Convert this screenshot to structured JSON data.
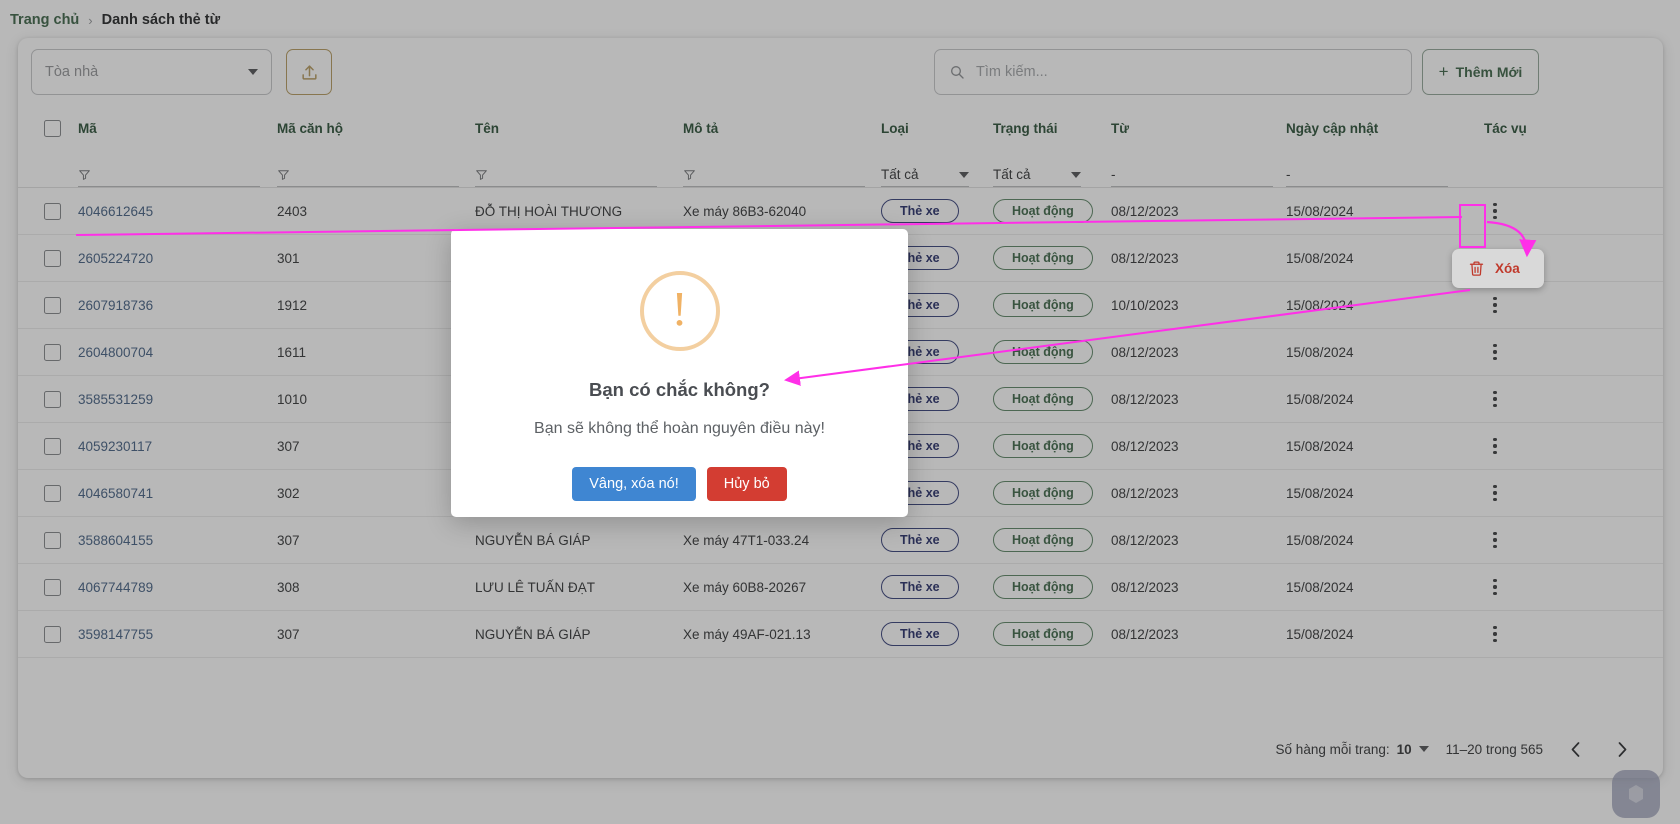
{
  "breadcrumb": {
    "home": "Trang chủ",
    "separator": "›",
    "current": "Danh sách thẻ từ"
  },
  "toolbar": {
    "building_placeholder": "Tòa nhà",
    "upload_icon": "upload-icon",
    "search_placeholder": "Tìm kiếm...",
    "search_value": "",
    "search_icon": "search-icon",
    "add_label": "Thêm Mới",
    "add_plus": "+"
  },
  "table": {
    "columns": [
      {
        "key": "ma",
        "label": "Mã"
      },
      {
        "key": "ma_can_ho",
        "label": "Mã căn hộ"
      },
      {
        "key": "ten",
        "label": "Tên"
      },
      {
        "key": "mo_ta",
        "label": "Mô tả"
      },
      {
        "key": "loai",
        "label": "Loại"
      },
      {
        "key": "trang_thai",
        "label": "Trạng thái"
      },
      {
        "key": "tu",
        "label": "Từ"
      },
      {
        "key": "ngay_cap_nhat",
        "label": "Ngày cập nhật"
      },
      {
        "key": "tac_vu",
        "label": "Tác vụ"
      }
    ],
    "filters": {
      "ma": "",
      "ma_can_ho": "",
      "ten": "",
      "mo_ta": "",
      "loai": "Tất cả",
      "trang_thai": "Tất cả",
      "tu": "-",
      "ngay_cap_nhat": "-"
    },
    "rows": [
      {
        "ma": "4046612645",
        "ma_can_ho": "2403",
        "ten": "ĐỖ THỊ HOÀI THƯƠNG",
        "mo_ta": "Xe máy 86B3-62040",
        "loai": "Thẻ xe",
        "trang_thai": "Hoạt động",
        "tu": "08/12/2023",
        "ngay_cap_nhat": "15/08/2024"
      },
      {
        "ma": "2605224720",
        "ma_can_ho": "301",
        "ten": "",
        "mo_ta": "",
        "loai": "Thẻ xe",
        "trang_thai": "Hoạt động",
        "tu": "08/12/2023",
        "ngay_cap_nhat": "15/08/2024"
      },
      {
        "ma": "2607918736",
        "ma_can_ho": "1912",
        "ten": "",
        "mo_ta": "",
        "loai": "Thẻ xe",
        "trang_thai": "Hoạt động",
        "tu": "10/10/2023",
        "ngay_cap_nhat": "15/08/2024"
      },
      {
        "ma": "2604800704",
        "ma_can_ho": "1611",
        "ten": "",
        "mo_ta": "",
        "loai": "Thẻ xe",
        "trang_thai": "Hoạt động",
        "tu": "08/12/2023",
        "ngay_cap_nhat": "15/08/2024"
      },
      {
        "ma": "3585531259",
        "ma_can_ho": "1010",
        "ten": "",
        "mo_ta": "",
        "loai": "Thẻ xe",
        "trang_thai": "Hoạt động",
        "tu": "08/12/2023",
        "ngay_cap_nhat": "15/08/2024"
      },
      {
        "ma": "4059230117",
        "ma_can_ho": "307",
        "ten": "",
        "mo_ta": "",
        "loai": "Thẻ xe",
        "trang_thai": "Hoạt động",
        "tu": "08/12/2023",
        "ngay_cap_nhat": "15/08/2024"
      },
      {
        "ma": "4046580741",
        "ma_can_ho": "302",
        "ten": "",
        "mo_ta": "",
        "loai": "Thẻ xe",
        "trang_thai": "Hoạt động",
        "tu": "08/12/2023",
        "ngay_cap_nhat": "15/08/2024"
      },
      {
        "ma": "3588604155",
        "ma_can_ho": "307",
        "ten": "NGUYỄN BÁ GIÁP",
        "mo_ta": "Xe máy 47T1-033.24",
        "loai": "Thẻ xe",
        "trang_thai": "Hoạt động",
        "tu": "08/12/2023",
        "ngay_cap_nhat": "15/08/2024"
      },
      {
        "ma": "4067744789",
        "ma_can_ho": "308",
        "ten": "LƯU LÊ TUẤN ĐẠT",
        "mo_ta": "Xe máy 60B8-20267",
        "loai": "Thẻ xe",
        "trang_thai": "Hoạt động",
        "tu": "08/12/2023",
        "ngay_cap_nhat": "15/08/2024"
      },
      {
        "ma": "3598147755",
        "ma_can_ho": "307",
        "ten": "NGUYỄN BÁ GIÁP",
        "mo_ta": "Xe máy 49AF-021.13",
        "loai": "Thẻ xe",
        "trang_thai": "Hoạt động",
        "tu": "08/12/2023",
        "ngay_cap_nhat": "15/08/2024"
      }
    ]
  },
  "pagination": {
    "rows_per_page_label": "Số hàng mỗi trang:",
    "rows_per_page_value": "10",
    "range_label": "11–20 trong 565",
    "prev_icon": "chevron-left-icon",
    "next_icon": "chevron-right-icon"
  },
  "context_menu": {
    "delete_label": "Xóa",
    "delete_icon": "trash-icon"
  },
  "modal": {
    "icon": "warning-exclamation-icon",
    "title": "Bạn có chắc không?",
    "subtitle": "Bạn sẽ không thể hoàn nguyên điều này!",
    "confirm_label": "Vâng, xóa nó!",
    "cancel_label": "Hủy bỏ"
  },
  "colors": {
    "accent_green": "#2e7d43",
    "link_blue": "#3b73b9",
    "badge_blue": "#2f3fb5",
    "badge_green": "#2f8043",
    "warning_orange": "#f0b265",
    "confirm_blue": "#3f86d2",
    "cancel_red": "#d33d32",
    "delete_red": "#c0392b",
    "annotation_magenta": "#ff2fe8",
    "upload_gold": "#d9a32a"
  }
}
